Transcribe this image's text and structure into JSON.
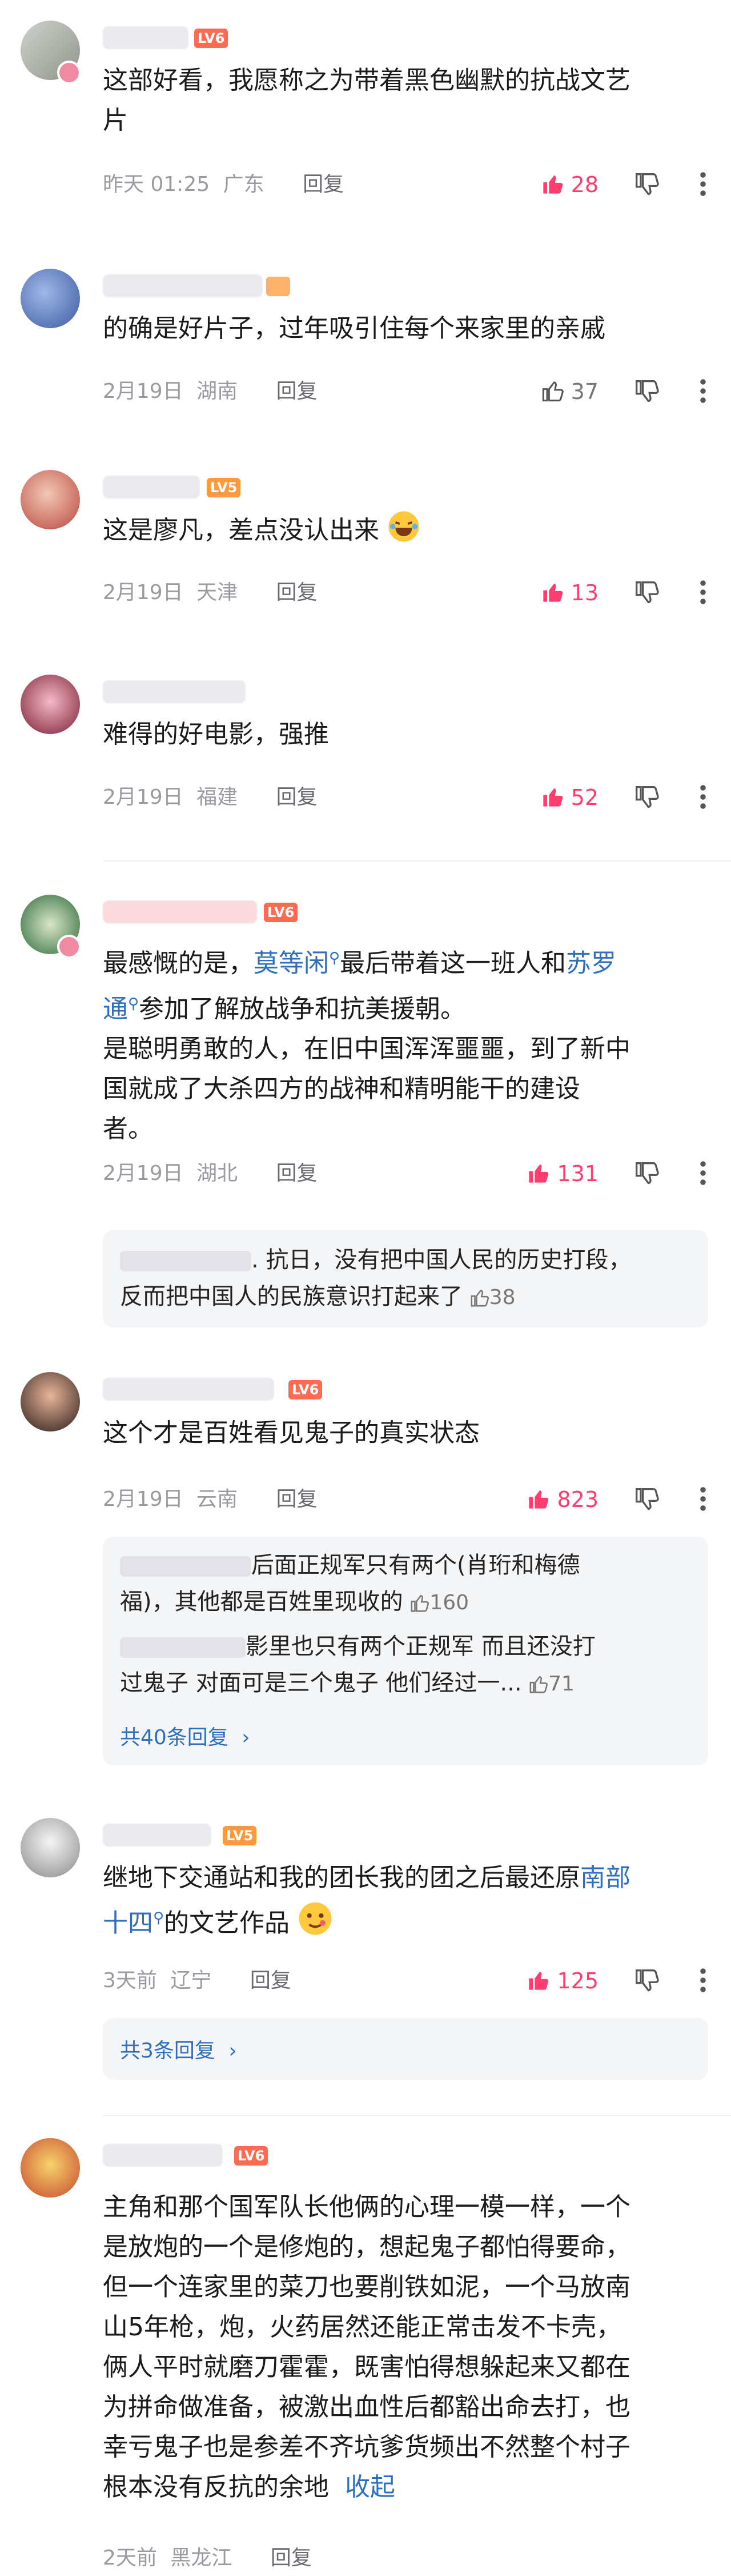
{
  "comments": [
    {
      "text_lines": [
        "这部好看，我愿称之为带着黑色幽默的抗战文艺",
        "片"
      ],
      "time": "昨天 01:25",
      "location": "广东",
      "reply": "回复",
      "likes": "28",
      "hot": true,
      "level": "LV6"
    },
    {
      "text_lines": [
        "的确是好片子，过年吸引住每个来家里的亲戚"
      ],
      "time": "2月19日",
      "location": "湖南",
      "reply": "回复",
      "likes": "37",
      "hot": false
    },
    {
      "text_lines": [
        "这是廖凡，差点没认出来"
      ],
      "time": "2月19日",
      "location": "天津",
      "reply": "回复",
      "likes": "13",
      "hot": true,
      "level": "LV5"
    },
    {
      "text_lines": [
        "难得的好电影，强推"
      ],
      "time": "2月19日",
      "location": "福建",
      "reply": "回复",
      "likes": "52",
      "hot": true
    },
    {
      "text": {
        "p1": "最感慨的是，",
        "link1": "莫等闲",
        "p2": "最后带着这一班人和",
        "link2a": "苏罗",
        "link2b": "通",
        "p3": "参加了解放战争和抗美援朝。",
        "line3": "是聪明勇敢的人，在旧中国浑浑噩噩，到了新中",
        "line4": "国就成了大杀四方的战神和精明能干的建设",
        "line5": "者。"
      },
      "time": "2月19日",
      "location": "湖北",
      "reply": "回复",
      "likes": "131",
      "hot": true,
      "level": "LV6",
      "subreplies": [
        {
          "lines": [
            ". 抗日，没有把中国人民的历史打段，",
            "反而把中国人的民族意识打起来了"
          ],
          "likes": "38"
        }
      ]
    },
    {
      "text_lines": [
        "这个才是百姓看见鬼子的真实状态"
      ],
      "time": "2月19日",
      "location": "云南",
      "reply": "回复",
      "likes": "823",
      "hot": true,
      "level": "LV6",
      "subreplies": [
        {
          "lines": [
            "后面正规军只有两个(肖珩和梅德",
            "福)，其他都是百姓里现收的"
          ],
          "likes": "160"
        },
        {
          "lines": [
            "影里也只有两个正规军 而且还没打",
            "过鬼子 对面可是三个鬼子 他们经过一..."
          ],
          "likes": "71"
        }
      ],
      "more_replies": "共40条回复"
    },
    {
      "text": {
        "p1": "继地下交通站和我的团长我的团之后最还原",
        "link1": "南部",
        "link2": "十四",
        "p2": "的文艺作品"
      },
      "time": "3天前",
      "location": "辽宁",
      "reply": "回复",
      "likes": "125",
      "hot": true,
      "level": "LV5",
      "more_replies": "共3条回复"
    },
    {
      "text_lines": [
        "主角和那个国军队长他俩的心理一模一样，一个",
        "是放炮的一个是修炮的，想起鬼子都怕得要命，",
        "但一个连家里的菜刀也要削铁如泥，一个马放南",
        "山5年枪，炮，火药居然还能正常击发不卡壳，",
        "俩人平时就磨刀霍霍，既害怕得想躲起来又都在",
        "为拼命做准备，被激出血性后都豁出命去打，也",
        "幸亏鬼子也是参差不齐坑爹货频出不然整个村子",
        "根本没有反抗的余地"
      ],
      "collapse": "收起",
      "time": "2天前",
      "location": "黑龙江",
      "reply": "回复",
      "level": "LV6"
    }
  ],
  "colors": {
    "hot": "#ff3d6e",
    "link": "#2f6fbf",
    "level": "#ff6b52"
  }
}
